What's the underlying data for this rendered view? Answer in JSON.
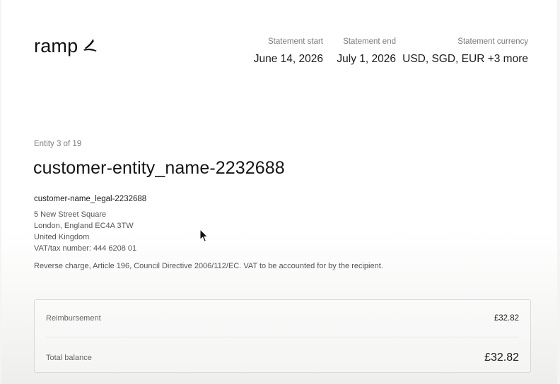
{
  "brand": {
    "name": "ramp",
    "logo_icon": "ramp-wing-icon"
  },
  "statement": {
    "start_label": "Statement start",
    "start_value": "June 14, 2026",
    "end_label": "Statement end",
    "end_value": "July 1, 2026",
    "currency_label": "Statement currency",
    "currency_value": "USD, SGD, EUR +3 more"
  },
  "entity": {
    "count_text": "Entity 3 of 19",
    "name": "customer-entity_name-2232688",
    "legal_name": "customer-name_legal-2232688",
    "address": {
      "line1": "5 New Street Square",
      "line2": "London, England EC4A 3TW",
      "country": "United Kingdom",
      "vat": "VAT/tax number: 444 6208 01"
    },
    "reverse_charge_note": "Reverse charge, Article 196, Council Directive 2006/112/EC. VAT to be accounted for by the recipient."
  },
  "summary": {
    "rows": [
      {
        "label": "Reimbursement",
        "amount": "£32.82"
      },
      {
        "label": "Total balance",
        "amount": "£32.82"
      }
    ]
  },
  "colors": {
    "text_primary": "#1b1b1b",
    "text_muted": "#7c7c7c",
    "border": "#d9d9d8"
  }
}
